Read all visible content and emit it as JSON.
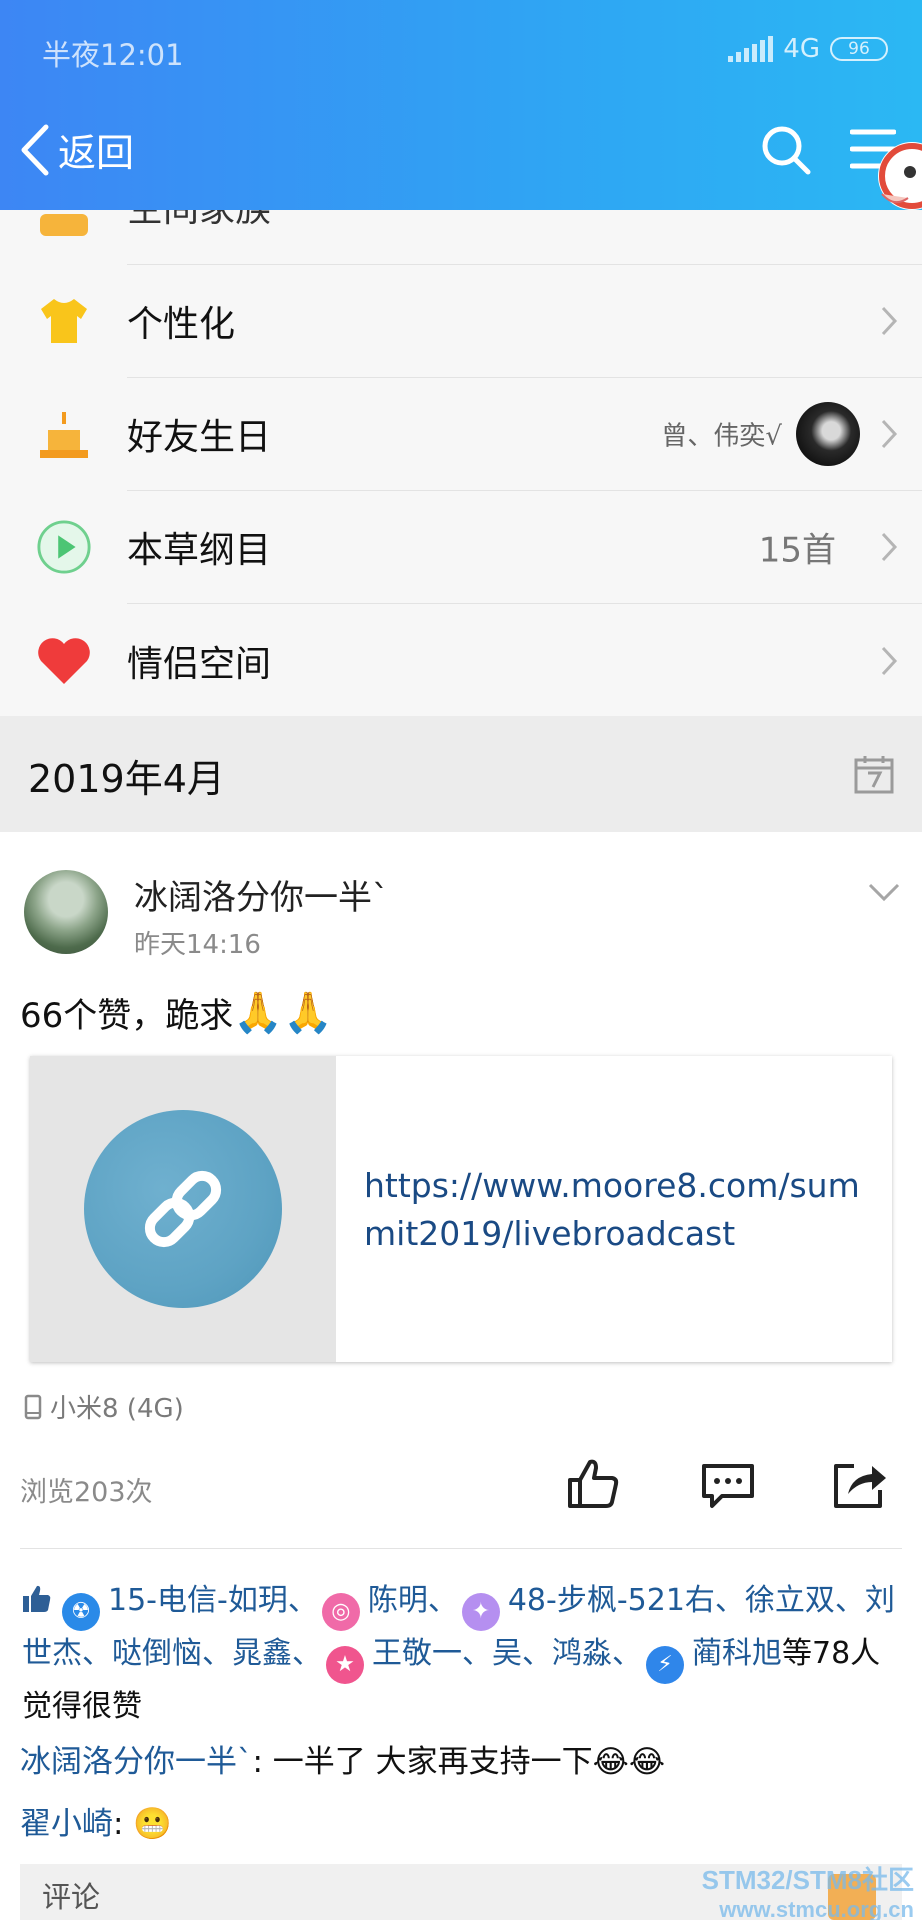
{
  "status_bar": {
    "time": "半夜12:01",
    "network": "4G",
    "battery": "96"
  },
  "header": {
    "back_label": "返回"
  },
  "menu_rows": [
    {
      "label": "空间家族",
      "value": ""
    },
    {
      "label": "个性化",
      "value": ""
    },
    {
      "label": "好友生日",
      "value": "曾、伟奕√"
    },
    {
      "label": "本草纲目",
      "value": "15首"
    },
    {
      "label": "情侣空间",
      "value": ""
    }
  ],
  "month": "2019年4月",
  "post": {
    "author": "冰阔洛分你一半`",
    "time": "昨天14:16",
    "text": "66个赞，跪求",
    "text_emoji": "🙏🙏",
    "link_url": "https://www.moore8.com/summit2019/livebroadcast",
    "device": "小米8 (4G)",
    "views": "浏览203次"
  },
  "likes": {
    "segment1": "15-电信-如玥、",
    "segment2": "陈明、",
    "segment3": "48-步枫-521右、徐立双、刘世杰、哒倒恼、晁鑫、",
    "segment4": "王敬一、吴、鸿淼、",
    "segment5": "蔺科旭",
    "suffix": "等78人觉得很赞"
  },
  "comments": [
    {
      "name": "冰阔洛分你一半`",
      "text": ": 一半了 大家再支持一下",
      "emoji": "😂😂"
    },
    {
      "name": "翟小崎",
      "text": ": ",
      "emoji": "😬"
    }
  ],
  "comment_box": {
    "placeholder": "评论"
  },
  "watermark": {
    "line1": "STM32/STM8社区",
    "line2": "www.stmcu.org.cn"
  },
  "colors": {
    "header_start": "#3d86f4",
    "header_end": "#2bb8f3",
    "link": "#1a4a84",
    "name": "#1f5a97"
  }
}
